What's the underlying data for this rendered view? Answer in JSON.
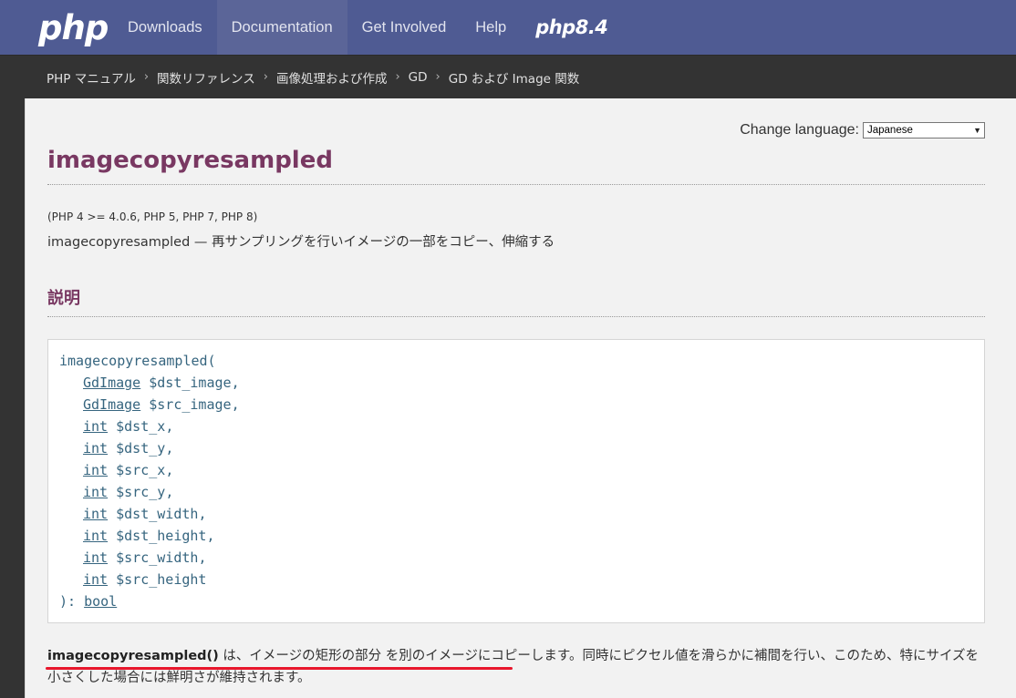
{
  "navbar": {
    "logo": "php",
    "items": [
      {
        "label": "Downloads"
      },
      {
        "label": "Documentation"
      },
      {
        "label": "Get Involved"
      },
      {
        "label": "Help"
      }
    ],
    "version_logo": "php8.4"
  },
  "breadcrumb": [
    "PHP マニュアル",
    "関数リファレンス",
    "画像処理および作成",
    "GD",
    "GD および Image 関数"
  ],
  "breadcrumb_separator": "›",
  "lang": {
    "label": "Change language:",
    "selected": "Japanese"
  },
  "page": {
    "title": "imagecopyresampled",
    "versions": "(PHP 4 >= 4.0.6, PHP 5, PHP 7, PHP 8)",
    "refname": "imagecopyresampled — 再サンプリングを行いイメージの一部をコピー、伸縮する",
    "section_title": "説明"
  },
  "signature": {
    "open": "imagecopyresampled(",
    "params": [
      {
        "type": "GdImage",
        "name": "$dst_image",
        "sep": ","
      },
      {
        "type": "GdImage",
        "name": "$src_image",
        "sep": ","
      },
      {
        "type": "int",
        "name": "$dst_x",
        "sep": ","
      },
      {
        "type": "int",
        "name": "$dst_y",
        "sep": ","
      },
      {
        "type": "int",
        "name": "$src_x",
        "sep": ","
      },
      {
        "type": "int",
        "name": "$src_y",
        "sep": ","
      },
      {
        "type": "int",
        "name": "$dst_width",
        "sep": ","
      },
      {
        "type": "int",
        "name": "$dst_height",
        "sep": ","
      },
      {
        "type": "int",
        "name": "$src_width",
        "sep": ","
      },
      {
        "type": "int",
        "name": "$src_height",
        "sep": ""
      }
    ],
    "close": "): ",
    "return_type": "bool"
  },
  "description": {
    "func": "imagecopyresampled()",
    "text": " は、イメージの矩形の部分 を別のイメージにコピーします。同時にピクセル値を滑らかに補間を行い、このため、特にサイズを小さくした場合には鮮明さが維持されます。"
  },
  "colors": {
    "navbar": "#4f5b93",
    "title": "#793862",
    "code": "#36657f",
    "annotation": "#e8162c"
  }
}
